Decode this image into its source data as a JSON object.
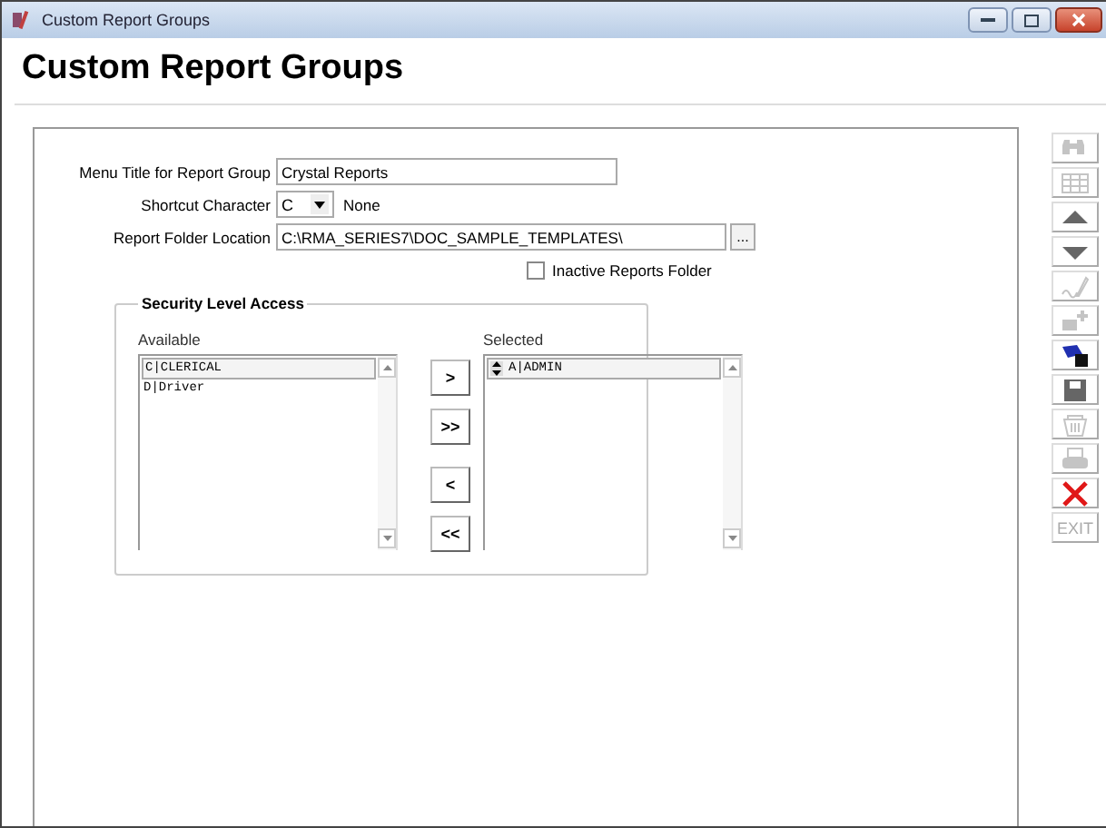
{
  "window": {
    "title": "Custom Report Groups"
  },
  "heading": "Custom Report Groups",
  "form": {
    "menu_title": {
      "label": "Menu Title for Report Group",
      "value": "Crystal Reports"
    },
    "shortcut": {
      "label": "Shortcut Character",
      "value": "C",
      "note": "None"
    },
    "folder": {
      "label": "Report Folder Location",
      "value": "C:\\RMA_SERIES7\\DOC_SAMPLE_TEMPLATES\\",
      "button": "..."
    },
    "inactive": {
      "label": "Inactive Reports Folder",
      "checked": false
    }
  },
  "security": {
    "title": "Security Level Access",
    "available": {
      "label": "Available",
      "items": [
        {
          "text": "C|CLERICAL",
          "selected": true
        },
        {
          "text": "D|Driver",
          "selected": false
        }
      ]
    },
    "buttons": [
      ">",
      ">>",
      "<",
      "<<"
    ],
    "selected": {
      "label": "Selected",
      "items": [
        {
          "text": "A|ADMIN",
          "selected": true
        }
      ]
    }
  },
  "toolbar": [
    {
      "kind": "search",
      "disabled": true
    },
    {
      "kind": "grid",
      "disabled": true
    },
    {
      "kind": "up",
      "disabled": false
    },
    {
      "kind": "down",
      "disabled": false
    },
    {
      "kind": "sign",
      "disabled": true
    },
    {
      "kind": "add",
      "disabled": true
    },
    {
      "kind": "blue",
      "disabled": false
    },
    {
      "kind": "save",
      "disabled": false
    },
    {
      "kind": "delete",
      "disabled": true
    },
    {
      "kind": "print",
      "disabled": true
    },
    {
      "kind": "close",
      "disabled": false
    },
    {
      "kind": "exit",
      "label": "EXIT",
      "disabled": true
    }
  ]
}
